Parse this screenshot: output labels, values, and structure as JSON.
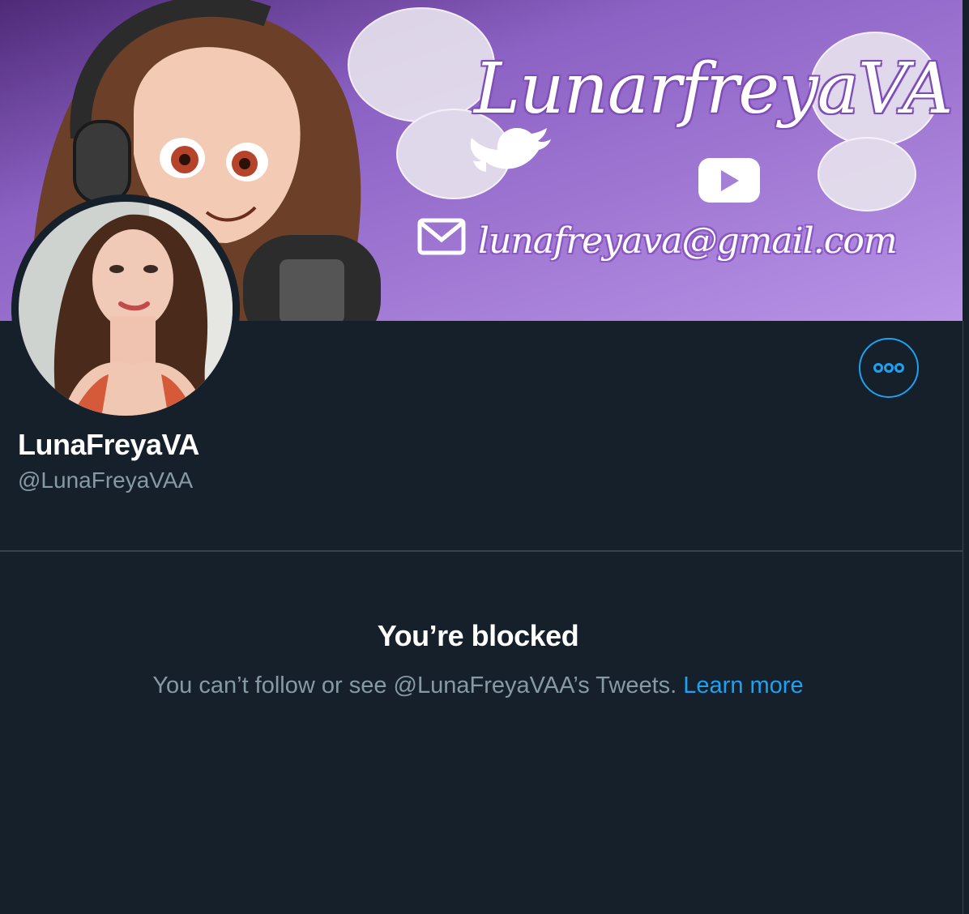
{
  "profile": {
    "display_name": "LunaFreyaVA",
    "handle": "@LunaFreyaVAA"
  },
  "banner": {
    "title_text": "LunarfreyaVA",
    "email_text": "lunafreyava@gmail.com",
    "icons": [
      "twitter-icon",
      "youtube-icon",
      "envelope-icon",
      "headphones-icon",
      "microphone-icon"
    ]
  },
  "more_button": {
    "icon": "ellipsis-icon"
  },
  "blocked": {
    "title": "You’re blocked",
    "description": "You can’t follow or see @LunaFreyaVAA’s Tweets.",
    "link_label": "Learn more"
  },
  "colors": {
    "background": "#15202b",
    "accent": "#1da1f2",
    "muted_text": "#8899a6",
    "divider": "#38444d",
    "banner_purple": "#a47fd6"
  }
}
